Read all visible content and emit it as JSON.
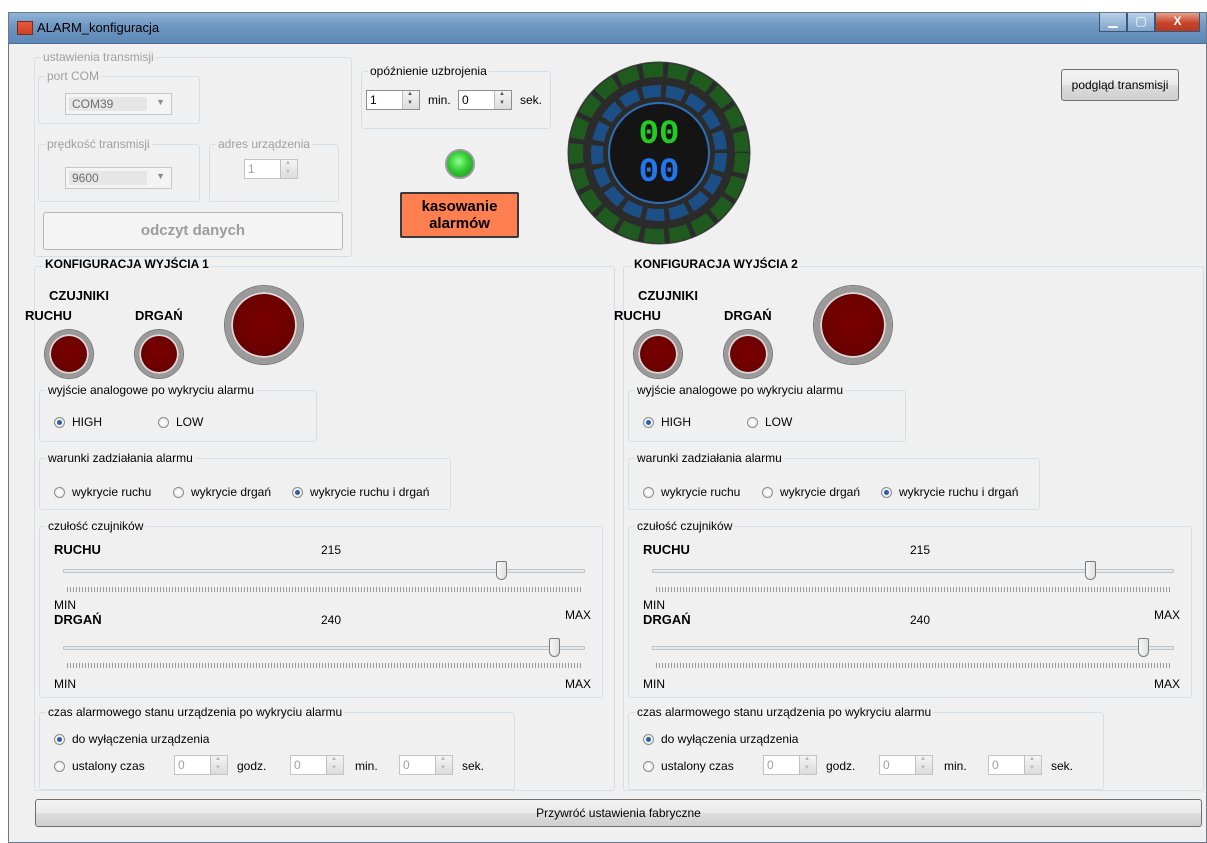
{
  "window": {
    "title": "ALARM_konfiguracja",
    "minimize": "▁",
    "maximize": "▢",
    "close": "X"
  },
  "transmission": {
    "group_label": "ustawienia transmisji",
    "port": {
      "label": "port COM",
      "value": "COM39"
    },
    "speed": {
      "label": "prędkość transmisji",
      "value": "9600"
    },
    "address": {
      "label": "adres urządzenia",
      "value": "1"
    },
    "read_button": "odczyt danych"
  },
  "arming_delay": {
    "label": "opóźnienie uzbrojenia",
    "minutes": "1",
    "min_unit": "min.",
    "seconds": "0",
    "sec_unit": "sek."
  },
  "status_led_color": "#33cc33",
  "reset_button": {
    "line1": "kasowanie",
    "line2": "alarmów",
    "color": "#ff7f50"
  },
  "display": {
    "top": "00",
    "bottom": "00",
    "top_color": "#22cc22",
    "bottom_color": "#2277ee"
  },
  "preview_button": "podgląd transmisji",
  "outputs": [
    {
      "title": "KONFIGURACJA WYJŚCIA 1",
      "sensors_label": "CZUJNIKI",
      "motion_label": "RUCHU",
      "vibration_label": "DRGAŃ",
      "analog": {
        "label": "wyjście analogowe po wykryciu alarmu",
        "high": "HIGH",
        "low": "LOW",
        "selected": "HIGH"
      },
      "conditions": {
        "label": "warunki zadziałania alarmu",
        "opt1": "wykrycie ruchu",
        "opt2": "wykrycie drgań",
        "opt3": "wykrycie ruchu i drgań",
        "selected": "opt3"
      },
      "sensitivity": {
        "label": "czułość czujników",
        "motion": {
          "label": "RUCHU",
          "value": "215",
          "level": 0.84
        },
        "vibration": {
          "label": "DRGAŃ",
          "value": "240",
          "level": 0.94
        },
        "min": "MIN",
        "max": "MAX"
      },
      "duration": {
        "label": "czas alarmowego stanu urządzenia po wykryciu alarmu",
        "opt1": "do wyłączenia urządzenia",
        "opt2": "ustalony czas",
        "hours": "0",
        "h_unit": "godz.",
        "minutes": "0",
        "m_unit": "min.",
        "seconds": "0",
        "s_unit": "sek.",
        "selected": "opt1"
      }
    },
    {
      "title": "KONFIGURACJA WYJŚCIA 2",
      "sensors_label": "CZUJNIKI",
      "motion_label": "RUCHU",
      "vibration_label": "DRGAŃ",
      "analog": {
        "label": "wyjście analogowe po wykryciu alarmu",
        "high": "HIGH",
        "low": "LOW",
        "selected": "HIGH"
      },
      "conditions": {
        "label": "warunki zadziałania alarmu",
        "opt1": "wykrycie ruchu",
        "opt2": "wykrycie drgań",
        "opt3": "wykrycie ruchu i drgań",
        "selected": "opt3"
      },
      "sensitivity": {
        "label": "czułość czujników",
        "motion": {
          "label": "RUCHU",
          "value": "215",
          "level": 0.84
        },
        "vibration": {
          "label": "DRGAŃ",
          "value": "240",
          "level": 0.94
        },
        "min": "MIN",
        "max": "MAX"
      },
      "duration": {
        "label": "czas alarmowego stanu urządzenia po wykryciu alarmu",
        "opt1": "do wyłączenia urządzenia",
        "opt2": "ustalony czas",
        "hours": "0",
        "h_unit": "godz.",
        "minutes": "0",
        "m_unit": "min.",
        "seconds": "0",
        "s_unit": "sek.",
        "selected": "opt1"
      }
    }
  ],
  "factory_reset_button": "Przywróć ustawienia fabryczne"
}
